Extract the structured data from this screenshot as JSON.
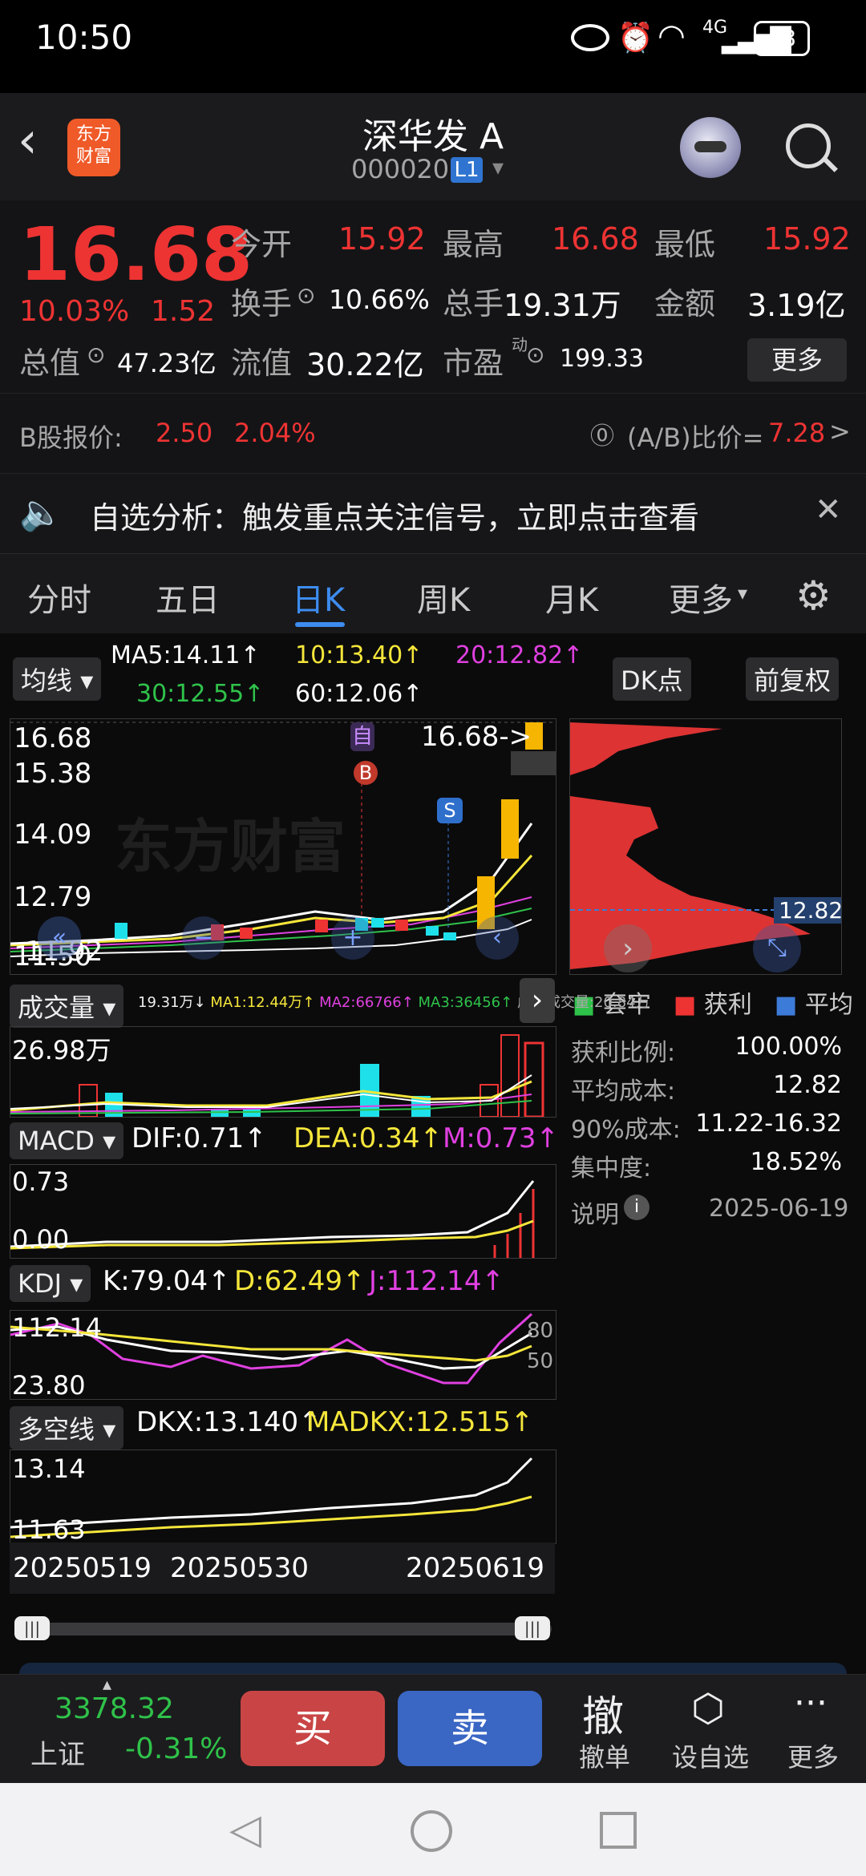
{
  "status": {
    "time": "10:50",
    "network": "4G",
    "battery": "68"
  },
  "header": {
    "app_logo": "东方\n财富",
    "stock_name": "深华发 A",
    "stock_code": "000020",
    "level_badge": "L1"
  },
  "quote": {
    "price": "16.68",
    "change_pct": "10.03%",
    "change_amt": "1.52",
    "open_label": "今开",
    "open": "15.92",
    "high_label": "最高",
    "high": "16.68",
    "low_label": "最低",
    "low": "15.92",
    "turnover_label": "换手",
    "turnover": "10.66%",
    "volume_label": "总手",
    "volume": "19.31万",
    "amount_label": "金额",
    "amount": "3.19亿",
    "mcap_label": "总值",
    "mcap": "47.23亿",
    "float_label": "流值",
    "float": "30.22亿",
    "pe_label": "市盈",
    "pe_sup": "动",
    "pe": "199.33",
    "more_button": "更多"
  },
  "bshare": {
    "label": "B股报价:",
    "price": "2.50",
    "pct": "2.04%",
    "ratio_label": "(A/B)比价=",
    "ratio": "7.28",
    "arrow": ">"
  },
  "notice": {
    "text": "自选分析：触发重点关注信号，立即点击查看",
    "close": "✕"
  },
  "tabs": [
    "分时",
    "五日",
    "日K",
    "周K",
    "月K",
    "更多"
  ],
  "ma": {
    "selector": "均线",
    "ma5": "MA5:14.11↑",
    "ma10": "10:13.40↑",
    "ma20": "20:12.82↑",
    "ma30": "30:12.55↑",
    "ma60": "60:12.06↑",
    "dk_button": "DK点",
    "fq_button": "前复权"
  },
  "kline": {
    "y1": "16.68",
    "y2": "15.38",
    "y3": "14.09",
    "y4": "12.79",
    "y5": "11.50",
    "last_label": "16.68->",
    "low_label": "11.92",
    "marker_zi": "自",
    "marker_b": "B",
    "marker_s": "S",
    "watermark": "东方财富"
  },
  "volume": {
    "selector": "成交量",
    "info_total": "19.31万↓",
    "info_ma1": "MA1:12.44万↑",
    "info_ma2": "MA2:66766↑",
    "info_ma3": "MA3:36456↑",
    "info_virtual": "虚拟成交量:20.84万",
    "ymax": "26.98万"
  },
  "macd": {
    "selector": "MACD",
    "dif": "DIF:0.71↑",
    "dea": "DEA:0.34↑",
    "m": "M:0.73↑",
    "y1": "0.73",
    "y2": "0.00"
  },
  "kdj": {
    "selector": "KDJ",
    "k": "K:79.04↑",
    "d": "D:62.49↑",
    "j": "J:112.14↑",
    "y1": "112.14",
    "y2": "23.80",
    "r80": "80",
    "r50": "50"
  },
  "dkx": {
    "selector": "多空线",
    "dkx": "DKX:13.140↑",
    "madkx": "MADKX:12.515↑",
    "y1": "13.14",
    "y2": "11.63"
  },
  "dates": [
    "20250519",
    "20250530",
    "20250619"
  ],
  "chips": {
    "avg_label": "12.82",
    "legend": [
      "套牢",
      "获利",
      "平均"
    ],
    "rows": [
      {
        "label": "获利比例:",
        "value": "100.00%"
      },
      {
        "label": "平均成本:",
        "value": "12.82"
      },
      {
        "label": "90%成本:",
        "value": "11.22-16.32"
      },
      {
        "label": "集中度:",
        "value": "18.52%"
      }
    ],
    "note_label": "说明",
    "date": "2025-06-19"
  },
  "bottom": {
    "index_value": "3378.32",
    "index_name": "上证",
    "index_pct": "-0.31%",
    "buy": "买",
    "sell": "卖",
    "cancel_icon": "撤",
    "cancel": "撤单",
    "watch": "设自选",
    "more": "更多"
  },
  "colors": {
    "up": "#ee3333",
    "down": "#2fc24a",
    "ma5": "#ffffff",
    "ma10": "#f5e63a",
    "ma20": "#e040e0",
    "ma30": "#2fc24a",
    "ma60": "#ffffff",
    "buy": "#c94545",
    "sell": "#3a66c4"
  }
}
